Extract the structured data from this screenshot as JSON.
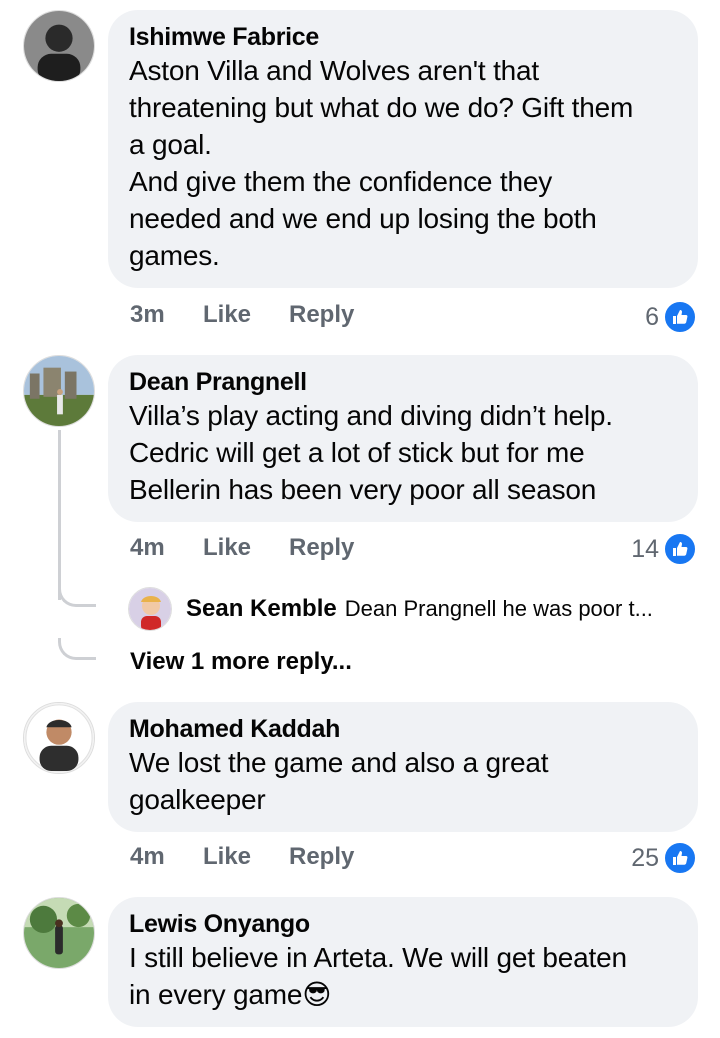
{
  "comments": [
    {
      "author": "Ishimwe Fabrice",
      "lines": [
        "Aston Villa and Wolves aren't that",
        "threatening but what do we do? Gift them",
        "a goal.",
        "And give them the confidence they",
        "needed and we end up losing the both",
        "games."
      ],
      "time": "3m",
      "like_label": "Like",
      "reply_label": "Reply",
      "reactions": "6"
    },
    {
      "author": "Dean Prangnell",
      "lines": [
        "Villa’s play acting and diving didn’t help.",
        "Cedric will get a lot of stick but for me",
        "Bellerin has been very poor all season"
      ],
      "time": "4m",
      "like_label": "Like",
      "reply_label": "Reply",
      "reactions": "14",
      "reply": {
        "author": "Sean Kemble",
        "text": "Dean Prangnell  he was poor t..."
      },
      "view_more": "View 1 more reply..."
    },
    {
      "author": "Mohamed Kaddah",
      "lines": [
        "We lost the game and also a great",
        "goalkeeper"
      ],
      "time": "4m",
      "like_label": "Like",
      "reply_label": "Reply",
      "reactions": "25"
    },
    {
      "author": "Lewis Onyango",
      "lines": [
        "I still believe in Arteta. We will get beaten",
        "in every game"
      ],
      "emoji": "😎"
    }
  ],
  "colors": {
    "bubble": "#f0f2f5",
    "like_blue": "#1877f2",
    "meta": "#606770"
  },
  "icons": {
    "reaction": "thumbs-up-icon"
  }
}
